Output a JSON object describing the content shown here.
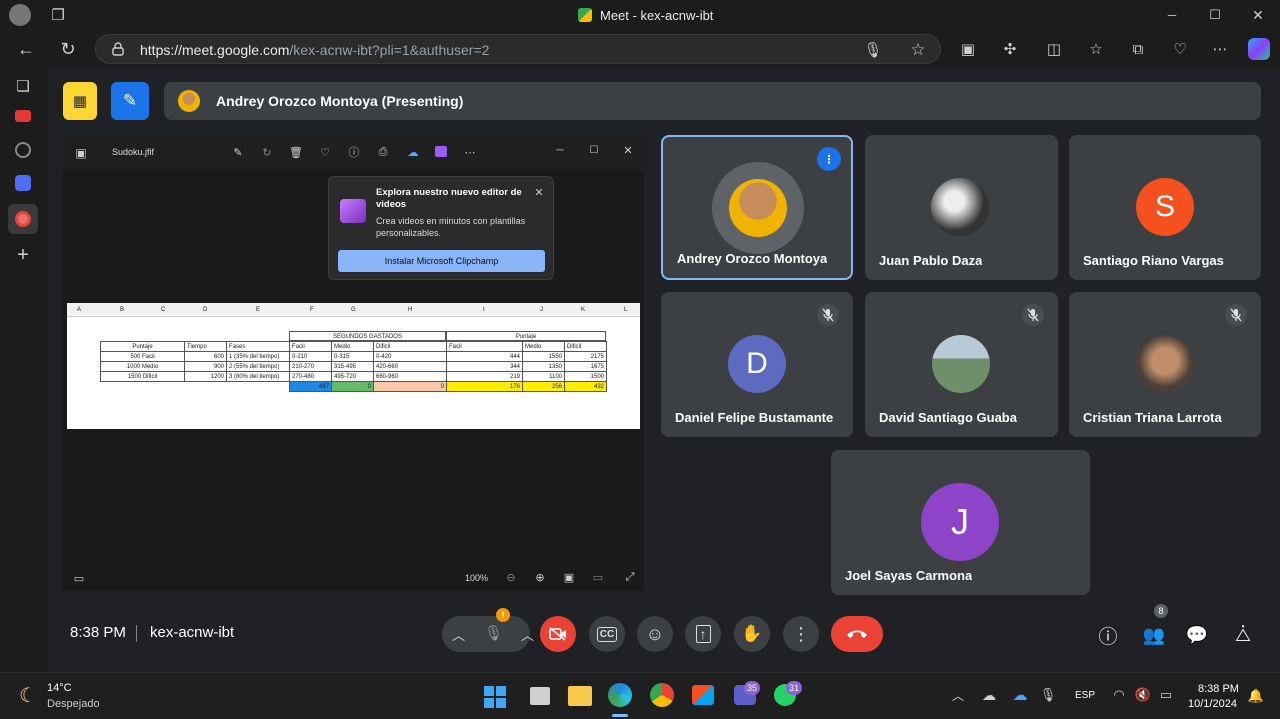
{
  "window": {
    "title": "Meet - kex-acnw-ibt",
    "controls": {
      "minimize": "─",
      "maximize": "☐",
      "close": "✕"
    }
  },
  "browser": {
    "url_host": "https://meet.google.com",
    "url_path": "/kex-acnw-ibt?pli=1&authuser=2"
  },
  "meeting": {
    "presenter_banner": "Andrey Orozco Montoya (Presenting)",
    "time": "8:38 PM",
    "code": "kex-acnw-ibt",
    "participants_count": "8",
    "mic_alert": "!"
  },
  "viewer": {
    "file_name": "Sudoku.jfif",
    "zoom": "100%",
    "popup": {
      "title": "Explora nuestro nuevo editor de videos",
      "body": "Crea videos en minutos con plantillas personalizables.",
      "button": "Instalar Microsoft Clipchamp"
    }
  },
  "sheet": {
    "col_letters": [
      "A",
      "B",
      "C",
      "D",
      "E",
      "F",
      "G",
      "H",
      "I",
      "J",
      "K",
      "L"
    ],
    "group_headers": [
      "SEGUNDOS GASTADOS",
      "Puntaje"
    ],
    "left_header": [
      "Puntaje",
      "Tiempo",
      "Fases"
    ],
    "sub_headers": [
      "Facil",
      "Medio",
      "Dificil",
      "Facil",
      "Medio",
      "Dificil"
    ],
    "rows": [
      [
        "500 Facil",
        "600",
        "1 (35% del tiempo)",
        "0-210",
        "0-315",
        "0-420",
        "444",
        "1550",
        "2175"
      ],
      [
        "1000 Medio",
        "900",
        "2 (55% del tiempo)",
        "210-270",
        "315-495",
        "420-660",
        "344",
        "1350",
        "1675"
      ],
      [
        "1500 Dificil",
        "1200",
        "3 (80% del tiempo)",
        "270-480",
        "495-720",
        "660-960",
        "219",
        "1100",
        "1500"
      ]
    ],
    "totals": [
      "487",
      "0",
      "0",
      "176",
      "256",
      "432"
    ]
  },
  "tiles": [
    {
      "name": "Andrey Orozco Montoya",
      "initial": "",
      "color": "#5f6368"
    },
    {
      "name": "Juan Pablo Daza",
      "initial": "",
      "color": "#222"
    },
    {
      "name": "Santiago Riano Vargas",
      "initial": "S",
      "color": "#f4511e"
    },
    {
      "name": "Daniel Felipe Bustamante",
      "initial": "D",
      "color": "#5c6bc0"
    },
    {
      "name": "David Santiago Guaba",
      "initial": "",
      "color": "#6d8f6a"
    },
    {
      "name": "Cristian Triana Larrota",
      "initial": "",
      "color": "#6b5a4c"
    },
    {
      "name": "Joel Sayas Carmona",
      "initial": "J",
      "color": "#8e44c9"
    }
  ],
  "taskbar": {
    "temp": "14°C",
    "weather": "Despejado",
    "lang": "ESP",
    "time": "8:38 PM",
    "date": "10/1/2024",
    "badge_teams": "35",
    "badge_whatsapp": "31"
  }
}
